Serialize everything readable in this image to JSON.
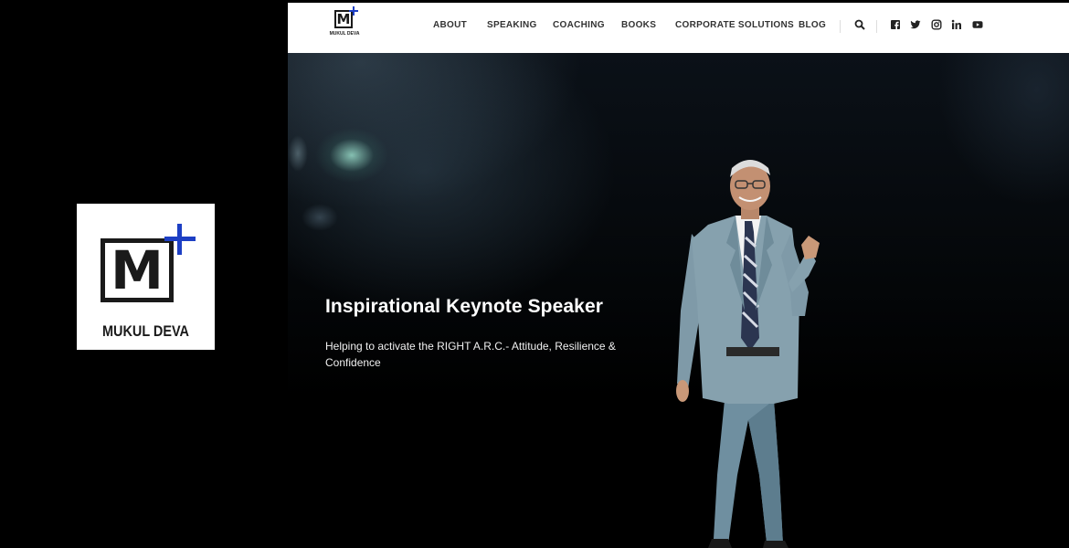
{
  "brand": {
    "name": "MUKUL DEVA",
    "mark_letter": "M",
    "plus_color": "#1d3fc4"
  },
  "nav": {
    "items": [
      "ABOUT",
      "SPEAKING",
      "COACHING",
      "BOOKS",
      "CORPORATE SOLUTIONS",
      "BLOG"
    ]
  },
  "header_icons": [
    "search-icon",
    "facebook-icon",
    "twitter-icon",
    "instagram-icon",
    "linkedin-icon",
    "youtube-icon"
  ],
  "hero": {
    "title": "Inspirational Keynote Speaker",
    "subtitle": "Helping to activate the RIGHT A.R.C.- Attitude, Resilience & Confidence"
  },
  "colors": {
    "header_bg": "#ffffff",
    "nav_text": "#333333",
    "hero_text": "#ffffff"
  }
}
